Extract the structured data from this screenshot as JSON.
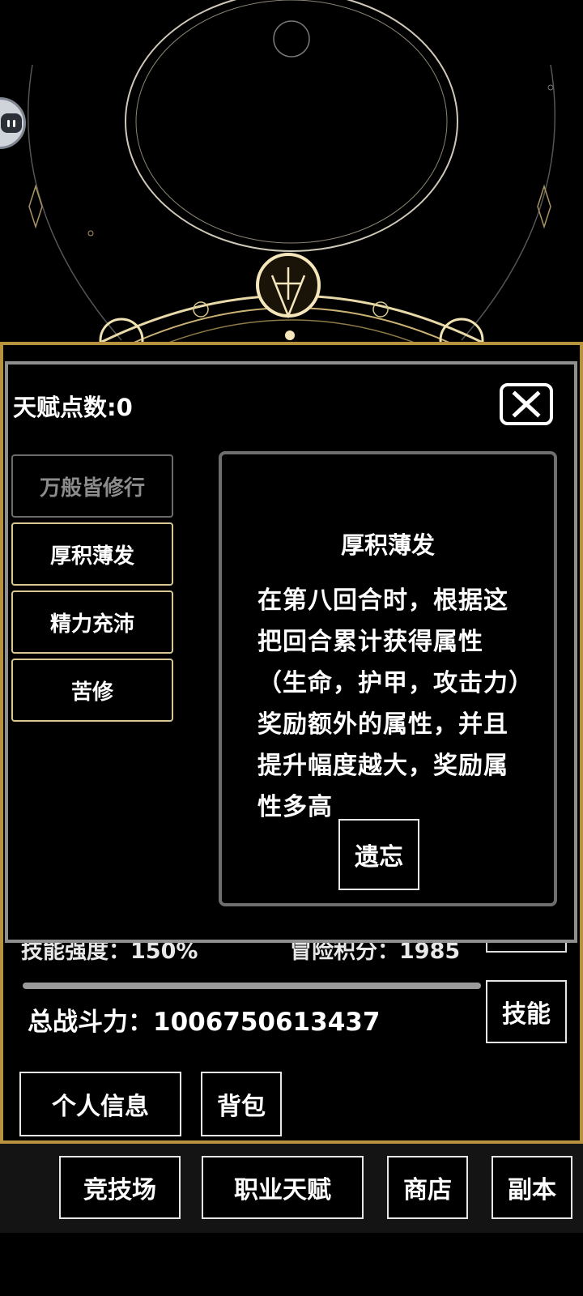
{
  "dialog": {
    "talent_points": "天赋点数:0",
    "tabs": [
      {
        "label": "万般皆修行",
        "active": true
      },
      {
        "label": "厚积薄发",
        "active": false
      },
      {
        "label": "精力充沛",
        "active": false
      },
      {
        "label": "苦修",
        "active": false
      }
    ],
    "detail": {
      "title": "厚积薄发",
      "description": "在第八回合时，根据这把回合累计获得属性（生命，护甲，攻击力）奖励额外的属性，并且提升幅度越大，奖励属性多高",
      "forget_label": "遗忘"
    },
    "close_icon": "close-icon"
  },
  "stats": {
    "skill_strength": "技能强度：150%",
    "adventure_points": "冒险积分：1985",
    "total_power": "总战斗力：1006750613437"
  },
  "buttons": {
    "skills": "技能",
    "profile": "个人信息",
    "bag": "背包"
  },
  "bottom_nav": [
    "竞技场",
    "职业天赋",
    "商店",
    "副本"
  ],
  "colors": {
    "gold_border": "#b8923e",
    "dialog_border": "#8f8f8f",
    "tab_border": "#d8c890"
  }
}
